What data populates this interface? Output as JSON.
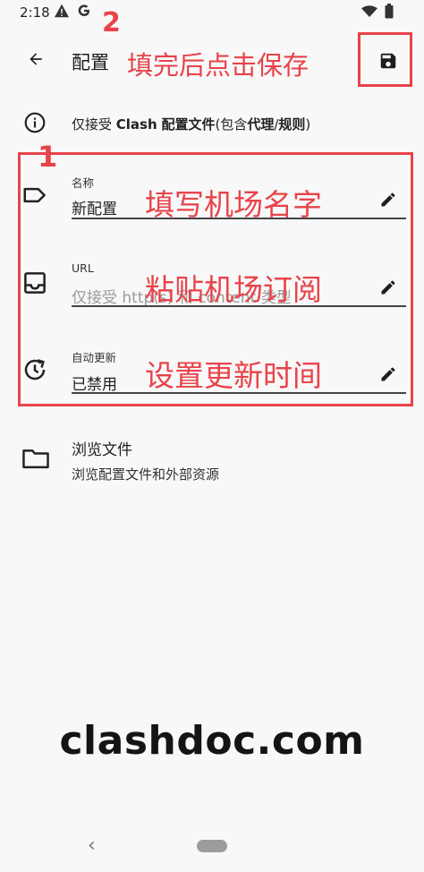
{
  "status_bar": {
    "time": "2:18",
    "left_icons": [
      "alert-icon",
      "google-icon"
    ],
    "right_icons": [
      "wifi-icon",
      "battery-icon"
    ]
  },
  "app_bar": {
    "title": "配置",
    "back_icon": "arrow-back-icon",
    "save_icon": "save-icon"
  },
  "info": {
    "prefix": "仅接受 ",
    "bold1": "Clash",
    "mid1": " ",
    "bold2": "配置文件",
    "mid2": "(包含",
    "bold3": "代理",
    "mid3": "/",
    "bold4": "规则",
    "suffix": ")"
  },
  "fields": [
    {
      "label": "名称",
      "value": "新配置",
      "is_placeholder": false,
      "icon": "label-tag-icon"
    },
    {
      "label": "URL",
      "value": "仅接受 http(s) 和 content 类型",
      "is_placeholder": true,
      "icon": "inbox-icon"
    },
    {
      "label": "自动更新",
      "value": "已禁用",
      "is_placeholder": false,
      "icon": "update-clock-icon"
    }
  ],
  "browse": {
    "title": "浏览文件",
    "subtitle": "浏览配置文件和外部资源",
    "icon": "folder-icon"
  },
  "annotations": {
    "step1": "1",
    "step2": "2",
    "save_hint": "填完后点击保存",
    "name_hint": "填写机场名字",
    "url_hint": "粘贴机场订阅",
    "update_hint": "设置更新时间",
    "color": "#e8434a"
  },
  "watermark": "clashdoc.com",
  "nav": {
    "back_glyph": "‹"
  }
}
